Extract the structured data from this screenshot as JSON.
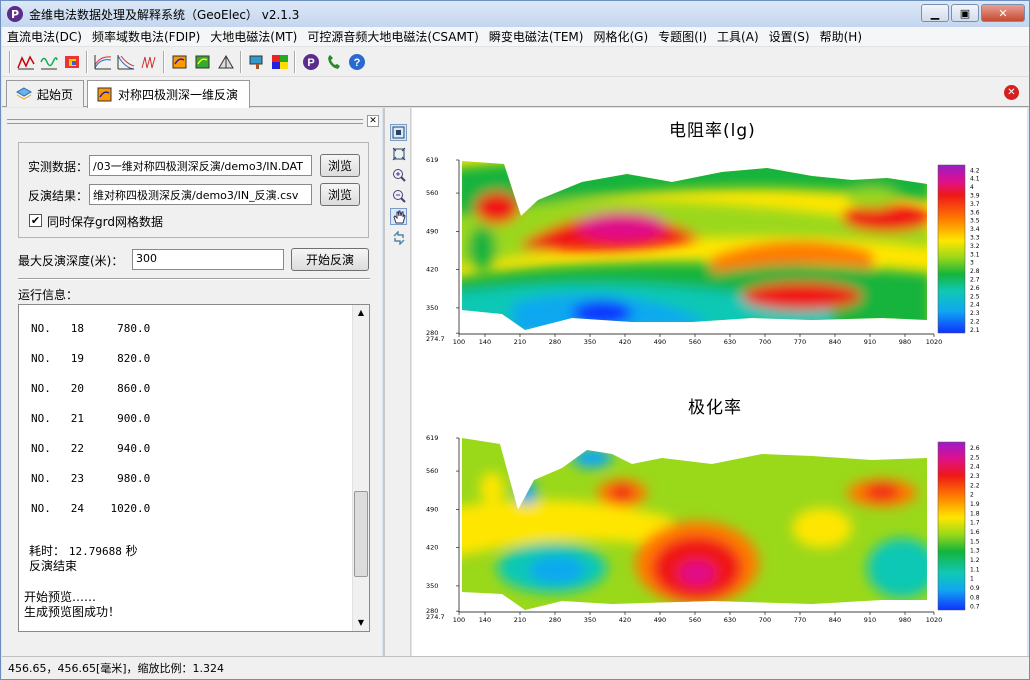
{
  "window": {
    "title": "金维电法数据处理及解释系统（GeoElec） v2.1.3",
    "app_icon_letter": "P"
  },
  "menu": [
    "直流电法(DC)",
    "频率域数电法(FDIP)",
    "大地电磁法(MT)",
    "可控源音频大地电磁法(CSAMT)",
    "瞬变电磁法(TEM)",
    "网格化(G)",
    "专题图(I)",
    "工具(A)",
    "设置(S)",
    "帮助(H)"
  ],
  "tabs": [
    {
      "label": "起始页"
    },
    {
      "label": "对称四极测深一维反演"
    }
  ],
  "form": {
    "observed_label": "实测数据：",
    "observed_value": "/03一维对称四极测深反演/demo3/IN.DAT",
    "result_label": "反演结果：",
    "result_value": "维对称四极测深反演/demo3/IN_反演.csv",
    "browse_label": "浏览",
    "save_grid_label": "同时保存grd网格数据",
    "save_grid_checked": true,
    "max_depth_label": "最大反演深度(米)：",
    "max_depth_value": "300",
    "start_label": "开始反演",
    "log_label": "运行信息："
  },
  "log": {
    "rows": [
      {
        "tag": "NO.",
        "no": "18",
        "val": "780.0"
      },
      {
        "tag": "NO.",
        "no": "19",
        "val": "820.0"
      },
      {
        "tag": "NO.",
        "no": "20",
        "val": "860.0"
      },
      {
        "tag": "NO.",
        "no": "21",
        "val": "900.0"
      },
      {
        "tag": "NO.",
        "no": "22",
        "val": "940.0"
      },
      {
        "tag": "NO.",
        "no": "23",
        "val": "980.0"
      },
      {
        "tag": "NO.",
        "no": "24",
        "val": "1020.0"
      }
    ],
    "time_label": "耗时：",
    "time_value": "12.79688",
    "time_unit": "秒",
    "done": "反演结束",
    "preview_start": "开始预览……",
    "preview_ok": "生成预览图成功！"
  },
  "charts": {
    "resistivity_title": "电阻率(lg)",
    "polarizability_title": "极化率",
    "x_ticks": [
      "100",
      "140",
      "210",
      "280",
      "350",
      "420",
      "490",
      "560",
      "630",
      "700",
      "770",
      "840",
      "910",
      "980",
      "1020"
    ],
    "y_ticks": [
      "619",
      "560",
      "490",
      "420",
      "350",
      "280",
      "274.7"
    ],
    "res_legend": [
      "4.2",
      "4.1",
      "4",
      "3.9",
      "3.7",
      "3.6",
      "3.5",
      "3.4",
      "3.3",
      "3.2",
      "3.1",
      "3",
      "2.8",
      "2.7",
      "2.6",
      "2.5",
      "2.4",
      "2.3",
      "2.2",
      "2.1"
    ],
    "pol_legend": [
      "2.6",
      "2.5",
      "2.4",
      "2.3",
      "2.2",
      "2",
      "1.9",
      "1.8",
      "1.7",
      "1.6",
      "1.5",
      "1.3",
      "1.2",
      "1.1",
      "1",
      "0.9",
      "0.8",
      "0.7"
    ]
  },
  "chart_data": [
    {
      "type": "heatmap",
      "title": "电阻率(lg)",
      "x_ticks": [
        100,
        140,
        210,
        280,
        350,
        420,
        490,
        560,
        630,
        700,
        770,
        840,
        910,
        980,
        1020
      ],
      "y_ticks": [
        619,
        560,
        490,
        420,
        350,
        280,
        274.7
      ],
      "colorbar": [
        4.2,
        4.1,
        4,
        3.9,
        3.7,
        3.6,
        3.5,
        3.4,
        3.3,
        3.2,
        3.1,
        3,
        2.8,
        2.7,
        2.6,
        2.5,
        2.4,
        2.3,
        2.2,
        2.1
      ]
    },
    {
      "type": "heatmap",
      "title": "极化率",
      "x_ticks": [
        100,
        140,
        210,
        280,
        350,
        420,
        490,
        560,
        630,
        700,
        770,
        840,
        910,
        980,
        1020
      ],
      "y_ticks": [
        619,
        560,
        490,
        420,
        350,
        280,
        274.7
      ],
      "colorbar": [
        2.6,
        2.5,
        2.4,
        2.3,
        2.2,
        2,
        1.9,
        1.8,
        1.7,
        1.6,
        1.5,
        1.3,
        1.2,
        1.1,
        1,
        0.9,
        0.8,
        0.7
      ]
    }
  ],
  "status": {
    "text": "456.65，456.65[毫米]，缩放比例：1.324"
  }
}
